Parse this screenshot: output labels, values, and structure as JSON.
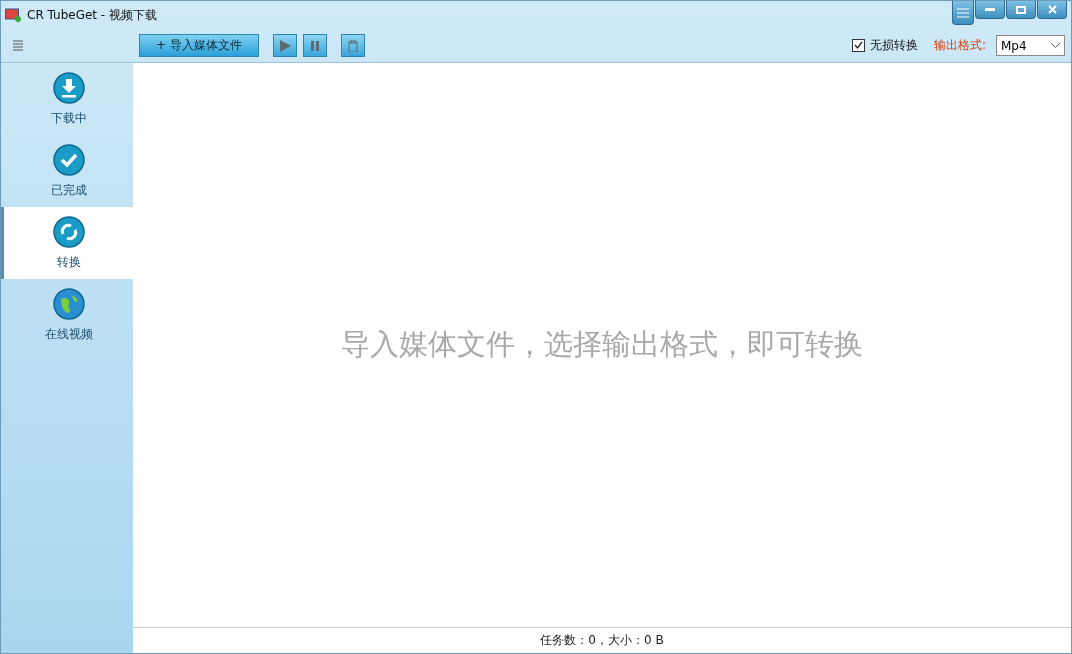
{
  "window": {
    "title": "CR TubeGet - 视频下载"
  },
  "toolbar": {
    "import_button": "+ 导入媒体文件",
    "lossless": {
      "label": "无损转换",
      "checked": true
    },
    "format_label": "输出格式:",
    "format": {
      "value": "Mp4"
    }
  },
  "sidebar": {
    "items": [
      {
        "kind": "download",
        "label": "下载中",
        "selected": false
      },
      {
        "kind": "done",
        "label": "已完成",
        "selected": false
      },
      {
        "kind": "convert",
        "label": "转换",
        "selected": true
      },
      {
        "kind": "globe",
        "label": "在线视频",
        "selected": false
      }
    ]
  },
  "main": {
    "hint": "导入媒体文件，选择输出格式，即可转换"
  },
  "status_bar": {
    "text": "任务数：0，大小：0 B"
  }
}
